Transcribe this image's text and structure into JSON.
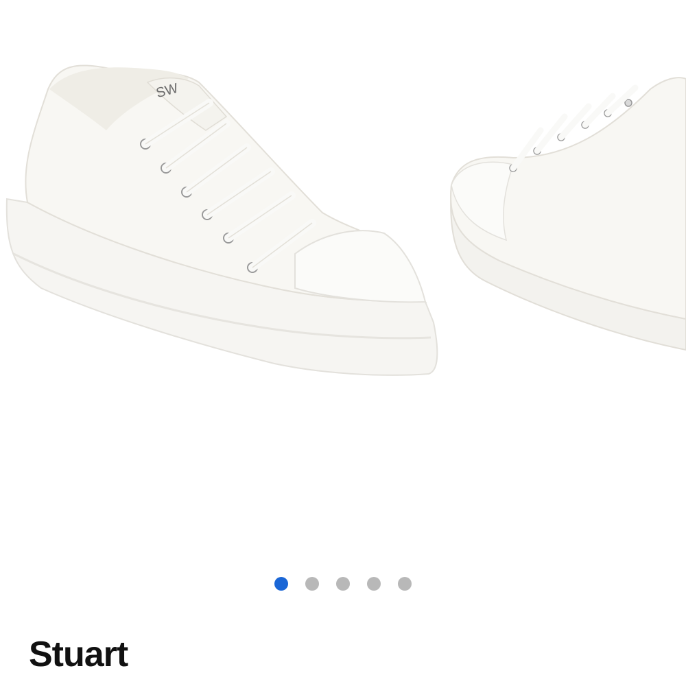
{
  "carousel": {
    "logo_text": "SW",
    "slide_count": 5,
    "active_index": 0,
    "active_color": "#1a66d6",
    "inactive_color": "#b8b8b8"
  },
  "product": {
    "brand": "Stuart"
  }
}
